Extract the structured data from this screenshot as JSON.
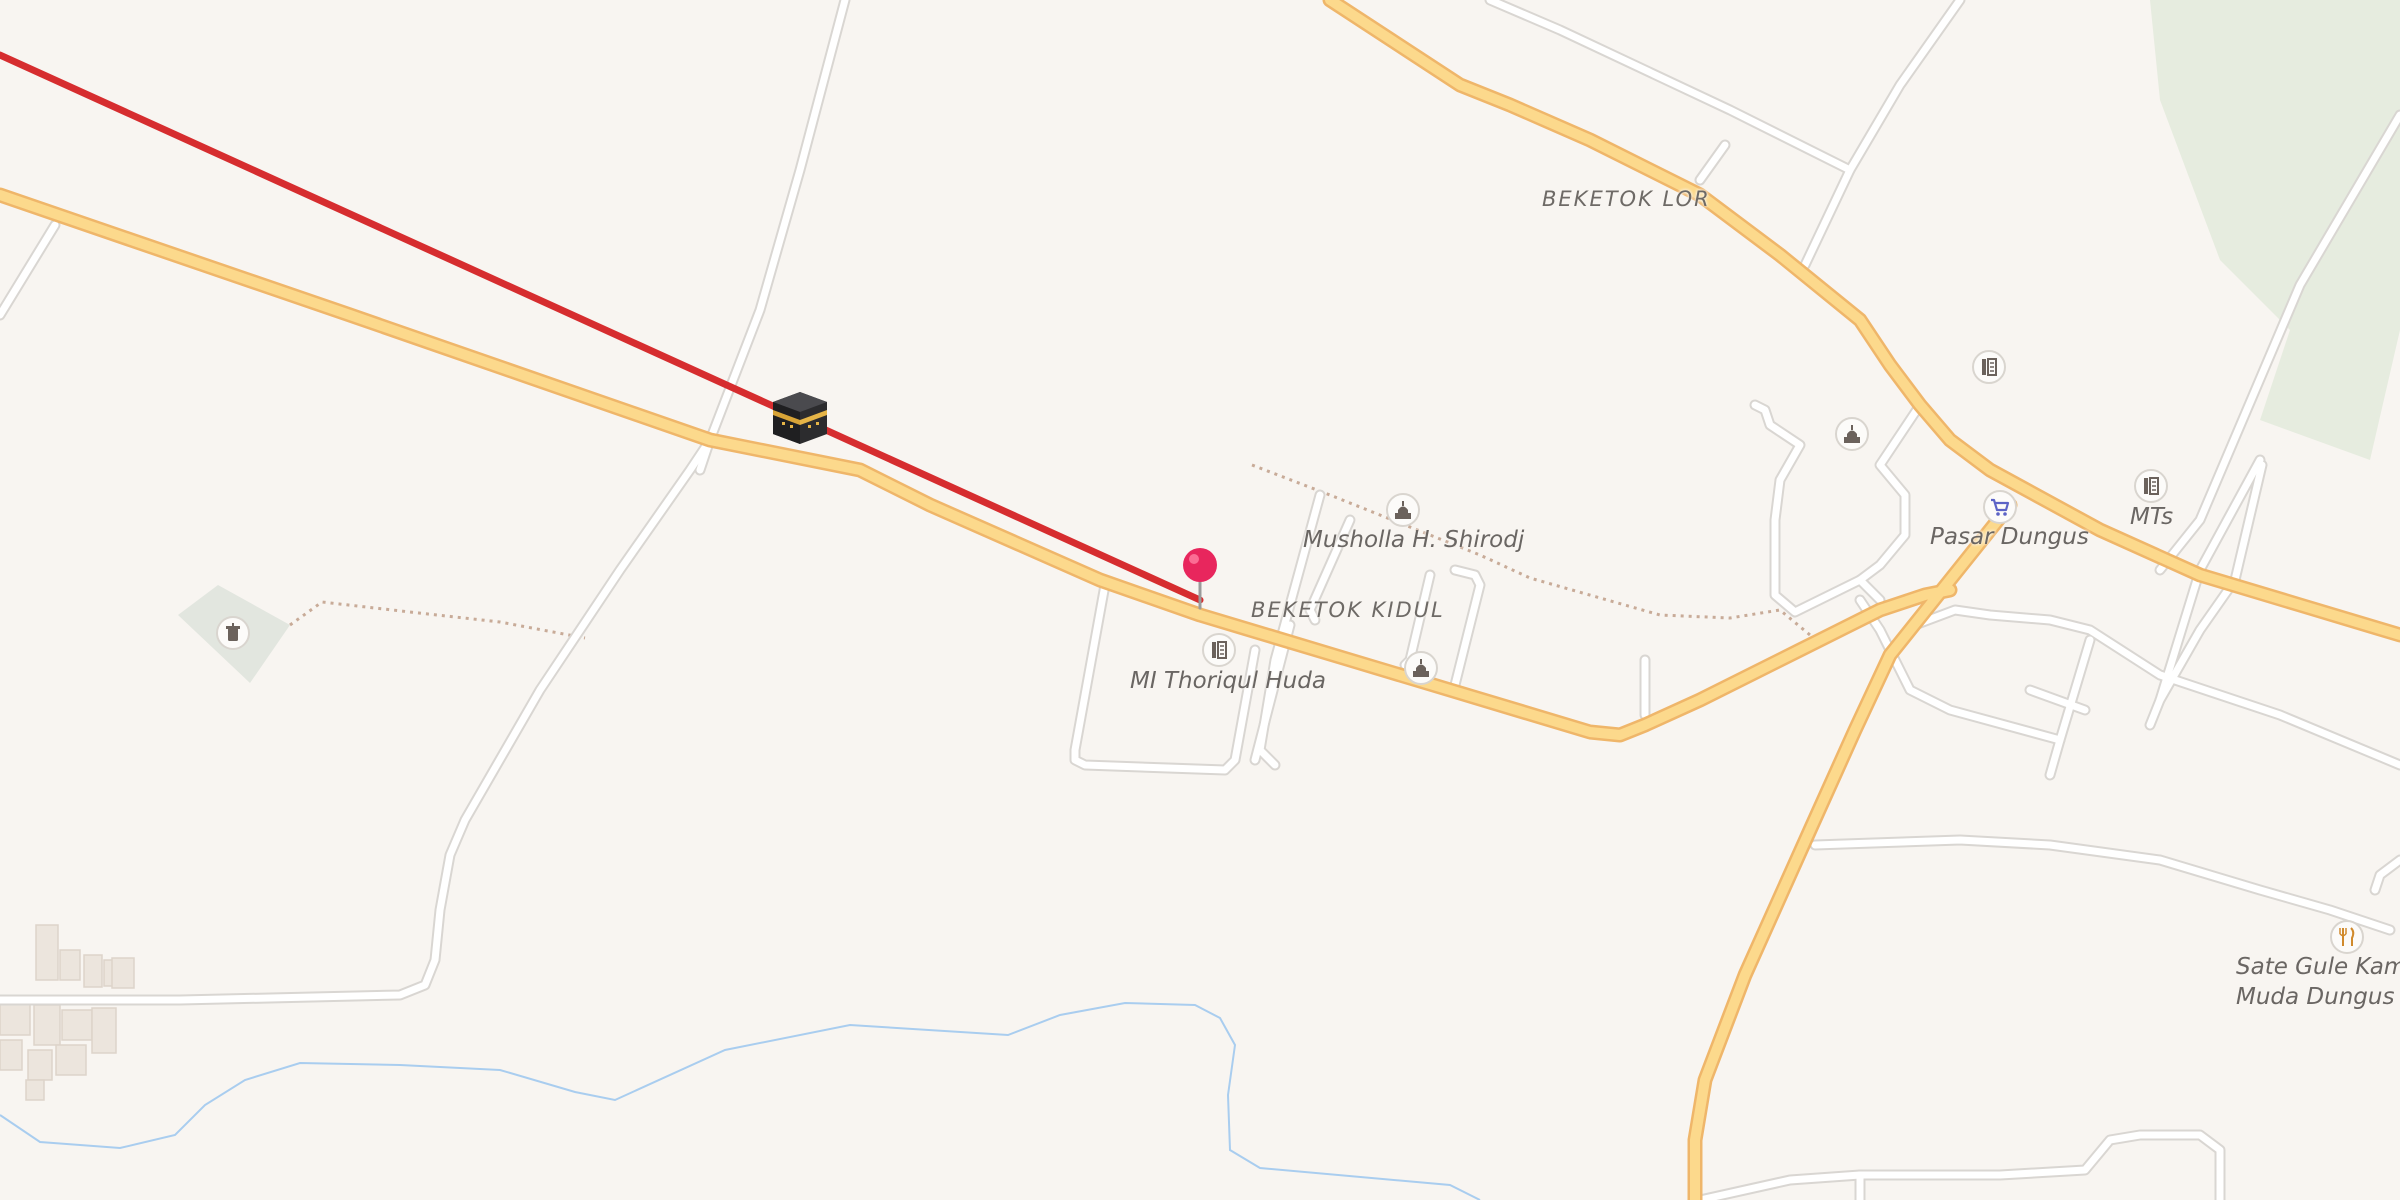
{
  "map": {
    "areas": [
      {
        "id": "beketok-lor",
        "label": "BEKETOK LOR"
      },
      {
        "id": "beketok-kidul",
        "label": "BEKETOK KIDUL"
      }
    ],
    "pois": [
      {
        "id": "musholla",
        "label": "Musholla H. Shirodj",
        "icon": "mosque-icon"
      },
      {
        "id": "mi-thoriqul",
        "label": "MI Thoriqul Huda",
        "icon": "school-icon"
      },
      {
        "id": "pasar",
        "label": "Pasar Dungus",
        "icon": "shopping-cart-icon"
      },
      {
        "id": "mts",
        "label": "MTs",
        "icon": "school-icon"
      },
      {
        "id": "sate",
        "label_line1": "Sate Gule Kam",
        "label_line2": "Muda Dungus M",
        "icon": "restaurant-icon"
      }
    ],
    "unlabeled_icons": [
      "cemetery-icon",
      "mosque-icon",
      "mosque-icon",
      "school-icon"
    ],
    "markers": [
      {
        "id": "kaaba",
        "icon": "kaaba-icon"
      },
      {
        "id": "location",
        "icon": "location-pin-icon",
        "color": "#e8265d"
      }
    ],
    "colors": {
      "background": "#f8f5f1",
      "main_road": "#fcd98c",
      "main_road_casing": "#efb66a",
      "minor_road": "#ffffff",
      "minor_road_casing": "#d9d6d2",
      "qibla_line": "#d62d2f",
      "river": "#a9cdef",
      "green_area": "#e5ecdf"
    }
  }
}
